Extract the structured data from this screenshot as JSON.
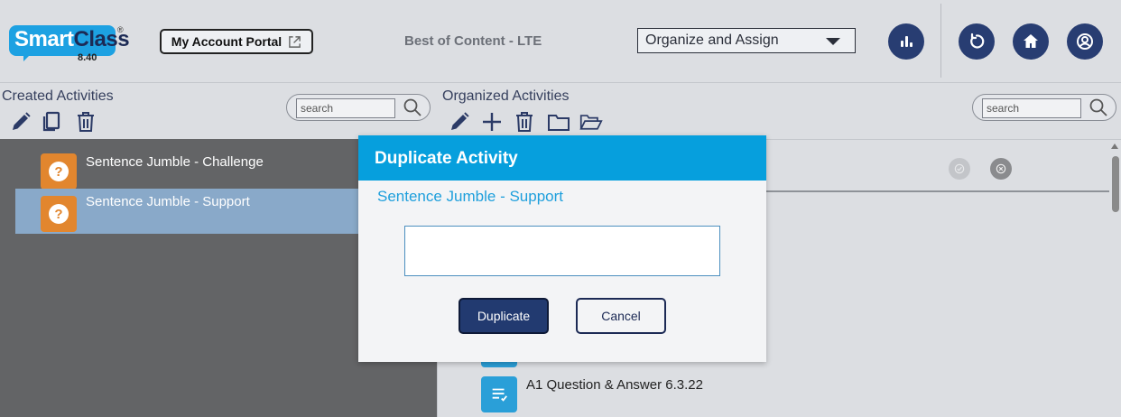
{
  "header": {
    "logo": {
      "smart": "Smart",
      "class": "Class",
      "reg": "®",
      "version": "8.40"
    },
    "portal_label": "My Account Portal",
    "app_title": "Best of Content - LTE",
    "mode_select": {
      "value": "Organize and Assign"
    },
    "icons": [
      "reports-icon",
      "refresh-icon",
      "home-icon",
      "account-icon"
    ]
  },
  "created": {
    "title": "Created Activities",
    "search_placeholder": "search",
    "items": [
      {
        "label": "Sentence Jumble - Challenge",
        "selected": false
      },
      {
        "label": "Sentence Jumble - Support",
        "selected": true
      }
    ]
  },
  "organized": {
    "title": "Organized Activities",
    "search_placeholder": "search",
    "items": [
      {
        "label": "A1 Question & Answer 6.3.22"
      }
    ]
  },
  "modal": {
    "title": "Duplicate Activity",
    "subtitle": "Sentence Jumble - Support",
    "input_value": "",
    "duplicate_label": "Duplicate",
    "cancel_label": "Cancel"
  },
  "colors": {
    "brand_blue": "#069fdd",
    "navy": "#223a70",
    "activity_orange": "#e2862e",
    "selected_row": "#89a9c9"
  }
}
